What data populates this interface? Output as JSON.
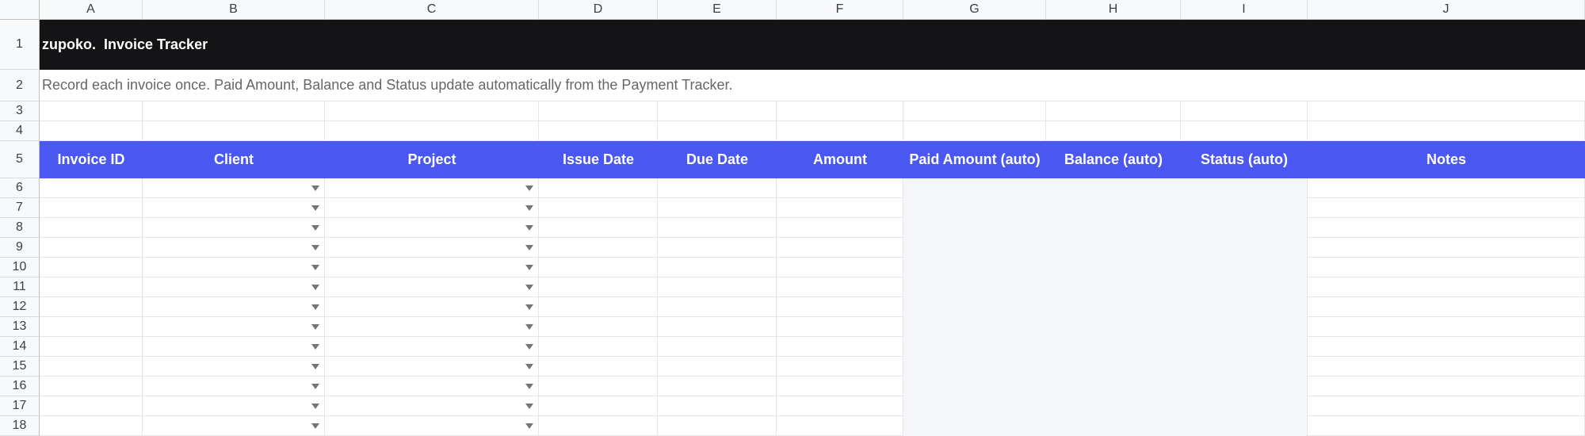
{
  "columns": [
    "A",
    "B",
    "C",
    "D",
    "E",
    "F",
    "G",
    "H",
    "I",
    "J"
  ],
  "row_numbers": [
    "1",
    "2",
    "3",
    "4",
    "5",
    "6",
    "7",
    "8",
    "9",
    "10",
    "11",
    "12",
    "13",
    "14",
    "15",
    "16",
    "17",
    "18"
  ],
  "title": {
    "brand": "zupoko.",
    "text": "Invoice Tracker"
  },
  "subtitle": "Record each invoice once. Paid Amount, Balance and Status update automatically from the Payment Tracker.",
  "headers": [
    "Invoice ID",
    "Client",
    "Project",
    "Issue Date",
    "Due Date",
    "Amount",
    "Paid Amount (auto)",
    "Balance (auto)",
    "Status (auto)",
    "Notes"
  ],
  "colors": {
    "title_bg": "#141416",
    "header_bg": "#4a57f0",
    "auto_bg": "#f5f6fa",
    "subtitle_text": "#666666"
  },
  "dropdown_icon": "triangle-down-icon"
}
